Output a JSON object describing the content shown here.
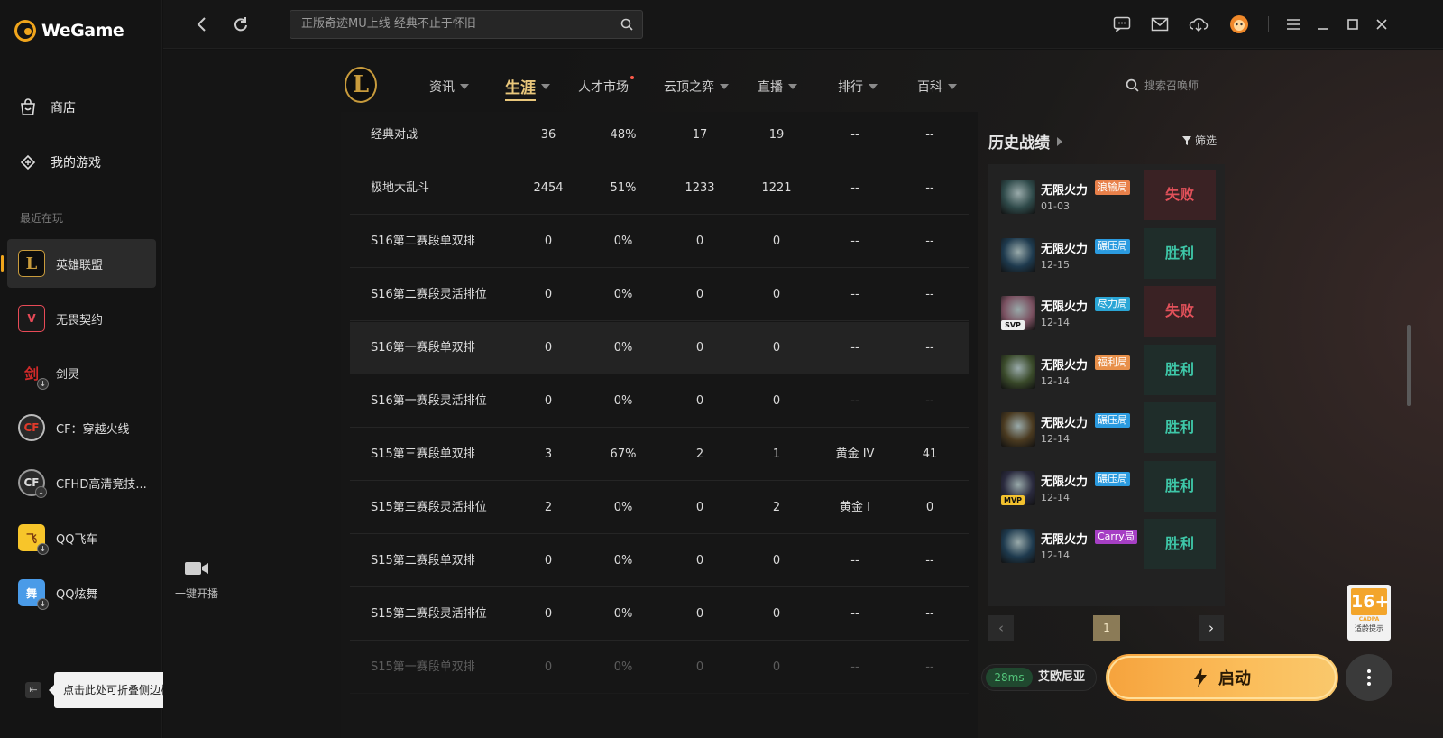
{
  "app": {
    "brand": "WeGame"
  },
  "sidebar": {
    "nav": [
      {
        "label": "商店",
        "icon": "shop-bag-icon"
      },
      {
        "label": "我的游戏",
        "icon": "my-games-icon"
      }
    ],
    "recent_label": "最近在玩",
    "games": [
      {
        "label": "英雄联盟",
        "active": true
      },
      {
        "label": "无畏契约"
      },
      {
        "label": "剑灵"
      },
      {
        "label": "CF：穿越火线"
      },
      {
        "label": "CFHD高清竞技..."
      },
      {
        "label": "QQ飞车"
      },
      {
        "label": "QQ炫舞"
      }
    ],
    "collapse_tooltip": "点击此处可折叠侧边栏"
  },
  "broadcast": {
    "label": "一键开播"
  },
  "topbar": {
    "search_text": "正版奇迹MU上线 经典不止于怀旧"
  },
  "lol_nav": {
    "tabs": [
      {
        "label": "资讯",
        "caret": true
      },
      {
        "label": "生涯",
        "caret": true,
        "active": true
      },
      {
        "label": "人才市场",
        "dot": true
      },
      {
        "label": "云顶之弈",
        "caret": true
      },
      {
        "label": "直播",
        "caret": true
      },
      {
        "label": "排行",
        "caret": true
      },
      {
        "label": "百科",
        "caret": true
      }
    ],
    "summoner_search_placeholder": "搜索召唤师"
  },
  "stats_table": {
    "rows": [
      [
        "经典对战",
        "36",
        "48%",
        "17",
        "19",
        "--",
        "--"
      ],
      [
        "极地大乱斗",
        "2454",
        "51%",
        "1233",
        "1221",
        "--",
        "--"
      ],
      [
        "S16第二赛段单双排",
        "0",
        "0%",
        "0",
        "0",
        "--",
        "--"
      ],
      [
        "S16第二赛段灵活排位",
        "0",
        "0%",
        "0",
        "0",
        "--",
        "--"
      ],
      [
        "S16第一赛段单双排",
        "0",
        "0%",
        "0",
        "0",
        "--",
        "--"
      ],
      [
        "S16第一赛段灵活排位",
        "0",
        "0%",
        "0",
        "0",
        "--",
        "--"
      ],
      [
        "S15第三赛段单双排",
        "3",
        "67%",
        "2",
        "1",
        "黄金 IV",
        "41"
      ],
      [
        "S15第三赛段灵活排位",
        "2",
        "0%",
        "0",
        "2",
        "黄金 I",
        "0"
      ],
      [
        "S15第二赛段单双排",
        "0",
        "0%",
        "0",
        "0",
        "--",
        "--"
      ],
      [
        "S15第二赛段灵活排位",
        "0",
        "0%",
        "0",
        "0",
        "--",
        "--"
      ],
      [
        "S15第一赛段单双排",
        "0",
        "0%",
        "0",
        "0",
        "--",
        "--"
      ]
    ],
    "highlighted_row": 4
  },
  "history": {
    "title": "历史战绩",
    "filter_label": "筛选",
    "matches": [
      {
        "mode": "无限火力",
        "tag": "浪输局",
        "tag_color": "#e8804a",
        "date": "01-03",
        "result": "失败",
        "win": false,
        "champ_color": "#2f4a4a",
        "badge": ""
      },
      {
        "mode": "无限火力",
        "tag": "碾压局",
        "tag_color": "#2b9be0",
        "date": "12-15",
        "result": "胜利",
        "win": true,
        "champ_color": "#1e3a4e",
        "badge": ""
      },
      {
        "mode": "无限火力",
        "tag": "尽力局",
        "tag_color": "#2aa6d6",
        "date": "12-14",
        "result": "失败",
        "win": false,
        "champ_color": "#7a5060",
        "badge": "SVP"
      },
      {
        "mode": "无限火力",
        "tag": "福利局",
        "tag_color": "#e8904a",
        "date": "12-14",
        "result": "胜利",
        "win": true,
        "champ_color": "#3a4a2a",
        "badge": ""
      },
      {
        "mode": "无限火力",
        "tag": "碾压局",
        "tag_color": "#2b9be0",
        "date": "12-14",
        "result": "胜利",
        "win": true,
        "champ_color": "#4a3a20",
        "badge": ""
      },
      {
        "mode": "无限火力",
        "tag": "碾压局",
        "tag_color": "#2b9be0",
        "date": "12-14",
        "result": "胜利",
        "win": true,
        "champ_color": "#2a2a3e",
        "badge": "MVP"
      },
      {
        "mode": "无限火力",
        "tag": "Carry局",
        "tag_color": "#a63fc4",
        "date": "12-14",
        "result": "胜利",
        "win": true,
        "champ_color": "#1e3a4e",
        "badge": ""
      }
    ],
    "current_page": "1"
  },
  "launch": {
    "ping": "28ms",
    "server": "艾欧尼亚",
    "button_label": "启动"
  },
  "age_rating": {
    "age": "16+",
    "org": "CADPA",
    "hint": "适龄提示"
  },
  "colors": {
    "accent": "#f0a51c",
    "gold": "#e9c77b",
    "win": "#3ec7a8",
    "loss": "#e2515a"
  }
}
